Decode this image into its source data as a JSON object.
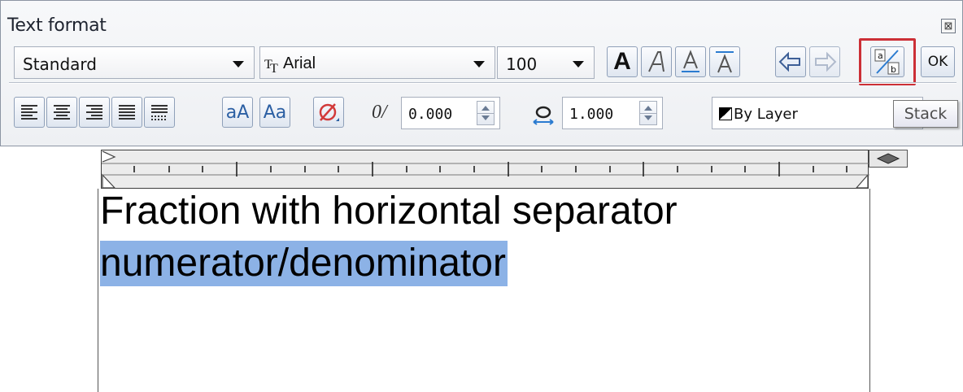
{
  "dialog": {
    "title": "Text format",
    "close_glyph": "⊠"
  },
  "toolbar1": {
    "style_combo": "Standard",
    "font_icon": "TrueType",
    "font_combo": "Arial",
    "height_combo": "100",
    "ok_label": "OK"
  },
  "toolbar2": {
    "case_lower_label": "aA",
    "case_title_label": "Aa",
    "oblique_glyph": "0/",
    "oblique_value": "0.000",
    "width_value": "1.000",
    "color_combo": "By Layer"
  },
  "tooltip": {
    "text": "Stack"
  },
  "editor": {
    "line1": "Fraction with horizontal separator",
    "line2": "numerator/denominator"
  },
  "colors": {
    "selection": "#8cb2e6",
    "stack_highlight": "#cc2f36"
  }
}
